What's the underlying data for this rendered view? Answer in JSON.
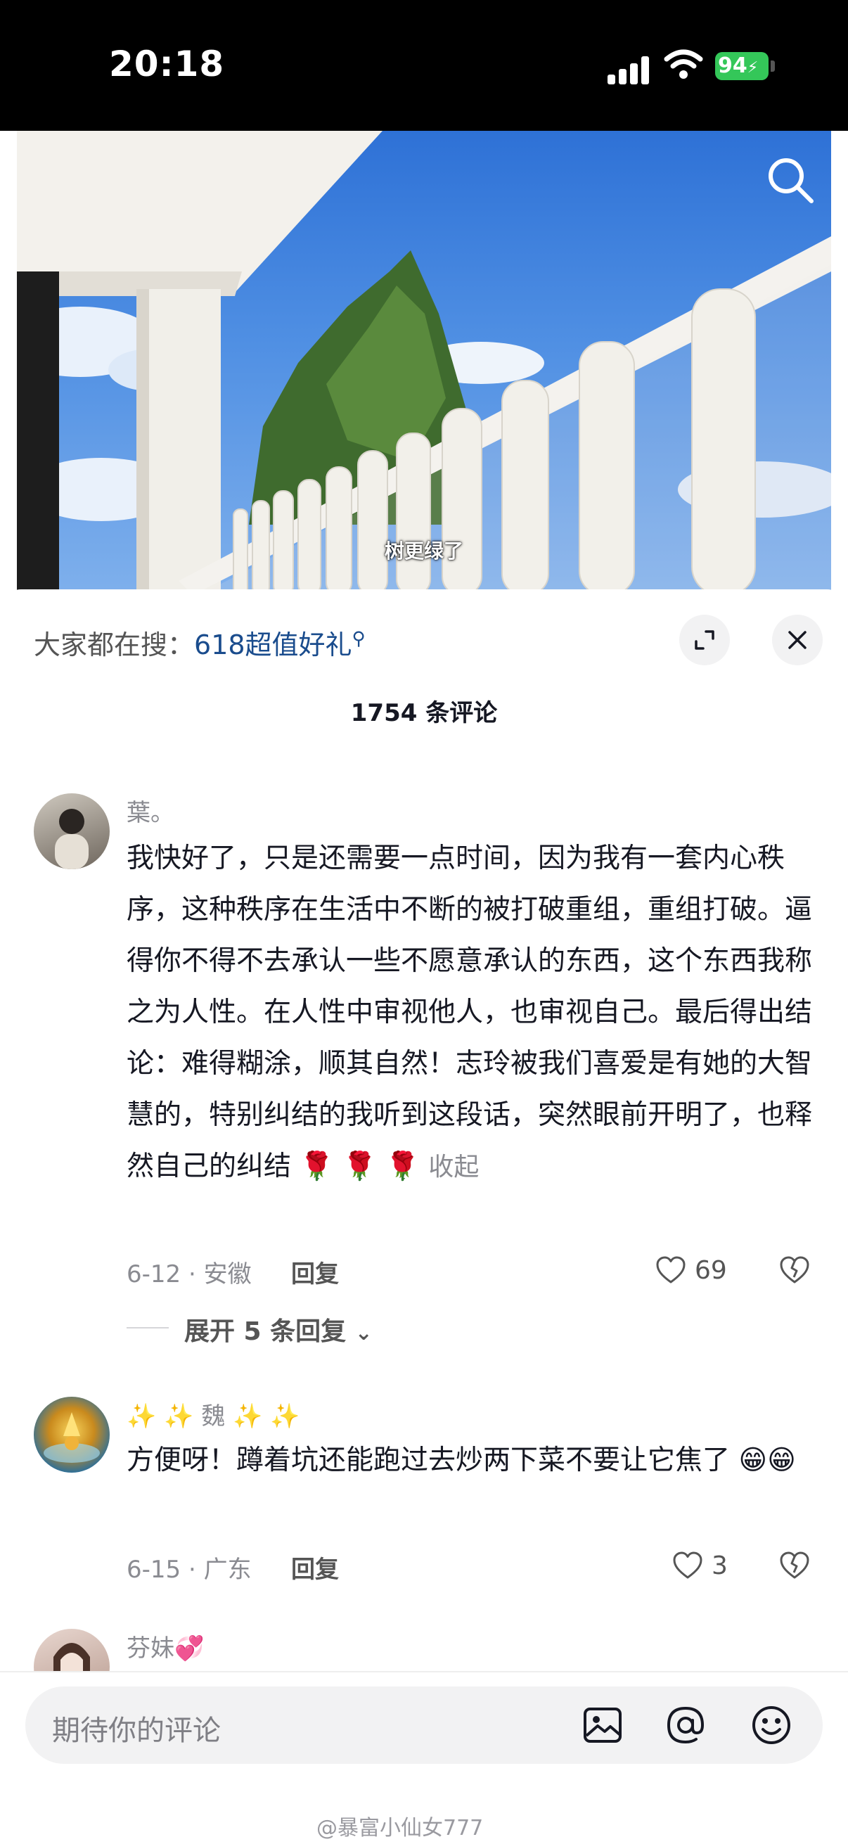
{
  "status": {
    "time": "20:18",
    "battery": "94"
  },
  "video": {
    "subtitle": "树更绿了",
    "search_icon": "search-icon"
  },
  "sheet": {
    "trending_prefix": "大家都在搜：",
    "trending_link": "618超值好礼",
    "comment_count": "1754 条评论"
  },
  "comments": [
    {
      "nickname": "葉。",
      "text": "我快好了，只是还需要一点时间，因为我有一套内心秩序，这种秩序在生活中不断的被打破重组，重组打破。逼得你不得不去承认一些不愿意承认的东西，这个东西我称之为人性。在人性中审视他人，也审视自己。最后得出结论：难得糊涂，顺其自然！志玲被我们喜爱是有她的大智慧的，特别纠结的我听到这段话，突然眼前开明了，也释然自己的纠结",
      "emoji": "🌹 🌹 🌹",
      "collapse": "收起",
      "date_loc": "6-12 · 安徽",
      "reply": "回复",
      "likes": "69",
      "expand_replies": "展开 5 条回复"
    },
    {
      "nickname": "✨ ✨ 魏 ✨ ✨",
      "text": "方便呀！蹲着坑还能跑过去炒两下菜不要让它焦了",
      "emoji": "😁😁",
      "date_loc": "6-15 · 广东",
      "reply": "回复",
      "likes": "3"
    },
    {
      "nickname": "芬妹💞"
    }
  ],
  "input": {
    "placeholder": "期待你的评论"
  },
  "watermark": "@暴富小仙女777",
  "colors": {
    "link": "#1a4c8d",
    "battery": "#34c759",
    "muted": "#8a8b91"
  }
}
